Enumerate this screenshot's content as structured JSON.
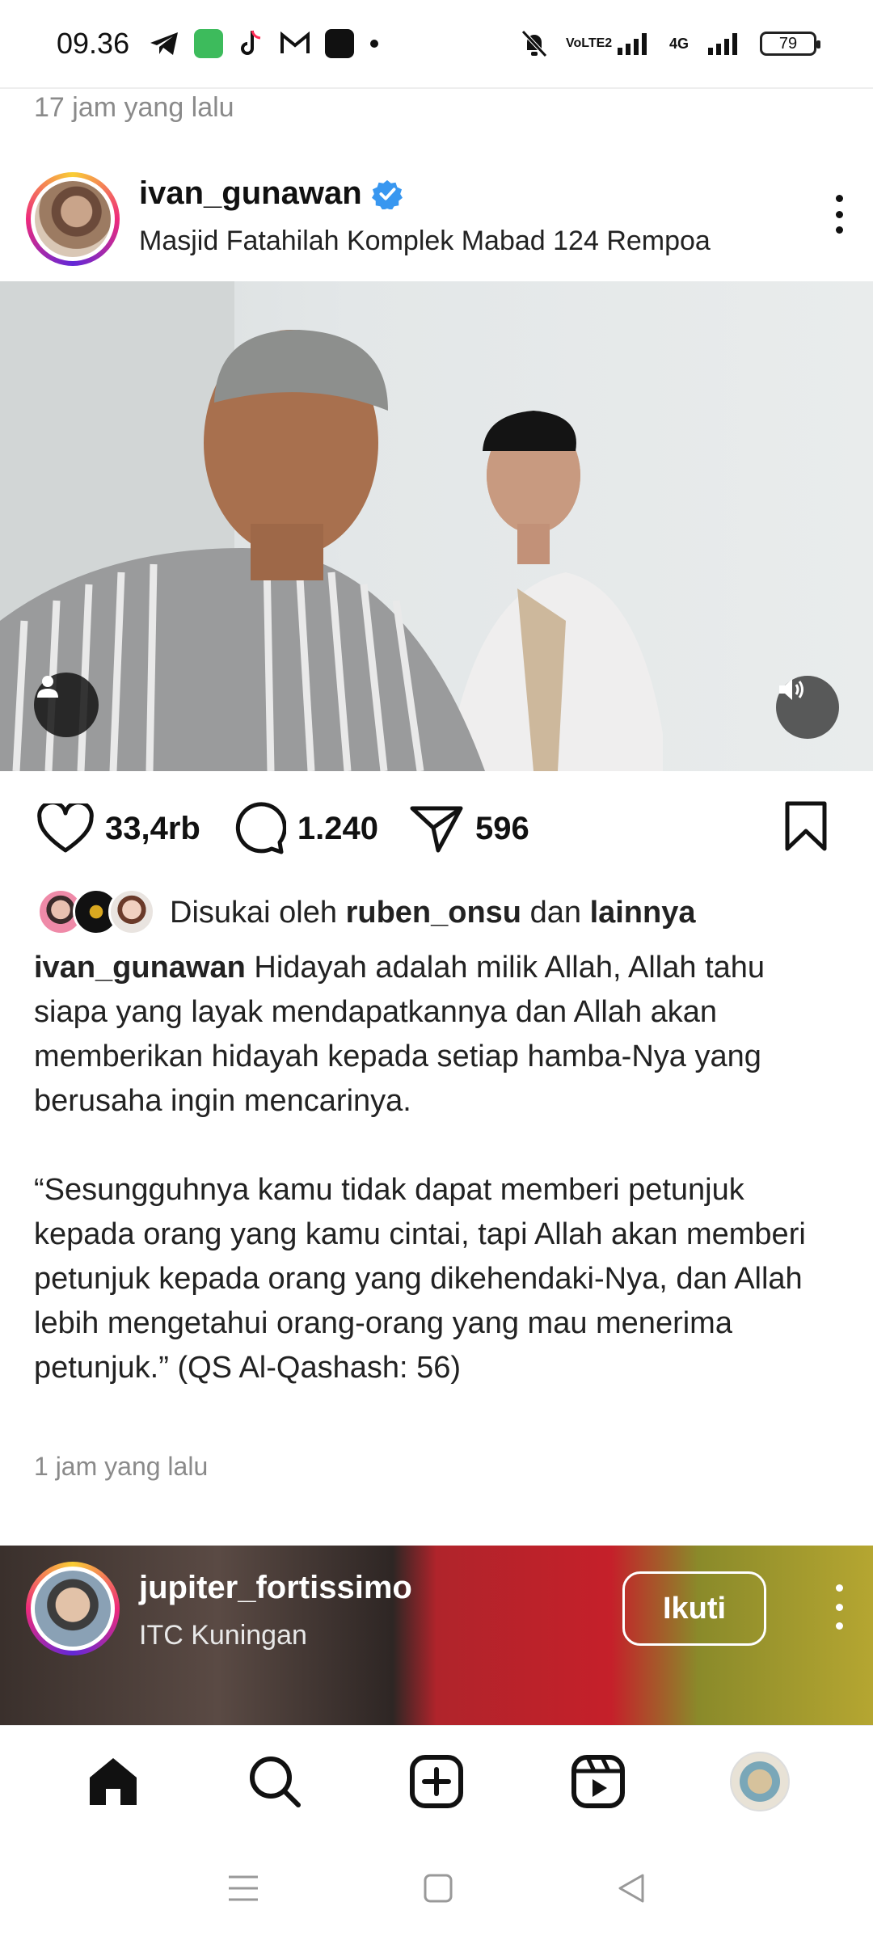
{
  "status_bar": {
    "time": "09.36",
    "network_label_1": "VoLTE2",
    "network_label_2": "4G",
    "battery": "79"
  },
  "feed": {
    "previous_post_time": "17 jam yang lalu"
  },
  "post": {
    "username": "ivan_gunawan",
    "verified": true,
    "location": "Masjid Fatahilah Komplek Mabad 124 Rempoa",
    "likes": "33,4rb",
    "comments": "1.240",
    "shares": "596",
    "liked_by_prefix": "Disukai oleh",
    "liked_by_user": "ruben_onsu",
    "liked_by_conj": "dan",
    "liked_by_others": "lainnya",
    "caption_user": "ivan_gunawan",
    "caption_para1": "Hidayah adalah milik Allah, Allah tahu siapa yang layak mendapatkannya dan Allah akan memberikan hidayah kepada setiap hamba-Nya yang berusaha ingin mencarinya.",
    "caption_para2": "“Sesungguhnya kamu tidak dapat memberi petunjuk kepada orang yang kamu cintai, tapi Allah akan memberi petunjuk kepada orang yang dikehendaki-Nya, dan Allah lebih mengetahui orang-orang yang mau menerima petunjuk.” (QS Al-Qashash: 56)",
    "time": "1 jam yang lalu"
  },
  "next_post": {
    "username": "jupiter_fortissimo",
    "location": "ITC Kuningan",
    "follow_label": "Ikuti"
  },
  "bottom_nav": {
    "items": [
      "home-icon",
      "search-icon",
      "create-icon",
      "reels-icon",
      "profile-avatar"
    ]
  },
  "colors": {
    "verified_blue": "#3897f0",
    "text": "#111111",
    "muted": "#8a8a8a"
  }
}
